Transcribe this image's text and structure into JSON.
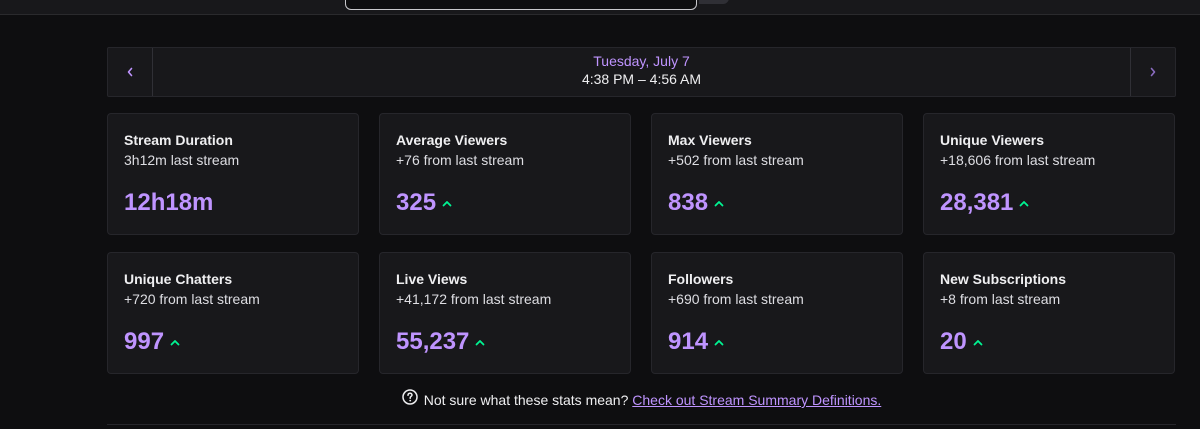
{
  "date_nav": {
    "date": "Tuesday, July 7",
    "time_range": "4:38 PM – 4:56 AM",
    "prev_icon": "chevron-left-icon",
    "next_icon": "chevron-right-icon"
  },
  "stats": [
    {
      "title": "Stream Duration",
      "sub": "3h12m last stream",
      "value": "12h18m",
      "trend": "none"
    },
    {
      "title": "Average Viewers",
      "sub": "+76 from last stream",
      "value": "325",
      "trend": "up"
    },
    {
      "title": "Max Viewers",
      "sub": "+502 from last stream",
      "value": "838",
      "trend": "up"
    },
    {
      "title": "Unique Viewers",
      "sub": "+18,606 from last stream",
      "value": "28,381",
      "trend": "up"
    },
    {
      "title": "Unique Chatters",
      "sub": "+720 from last stream",
      "value": "997",
      "trend": "up"
    },
    {
      "title": "Live Views",
      "sub": "+41,172 from last stream",
      "value": "55,237",
      "trend": "up"
    },
    {
      "title": "Followers",
      "sub": "+690 from last stream",
      "value": "914",
      "trend": "up"
    },
    {
      "title": "New Subscriptions",
      "sub": "+8 from last stream",
      "value": "20",
      "trend": "up"
    }
  ],
  "footer": {
    "question": "Not sure what these stats mean?",
    "link_text": "Check out Stream Summary Definitions.",
    "help_icon": "question-circle-icon"
  },
  "colors": {
    "accent": "#bf94ff",
    "trend_up": "#00f593",
    "background": "#0e0e10",
    "card": "#18181b"
  }
}
